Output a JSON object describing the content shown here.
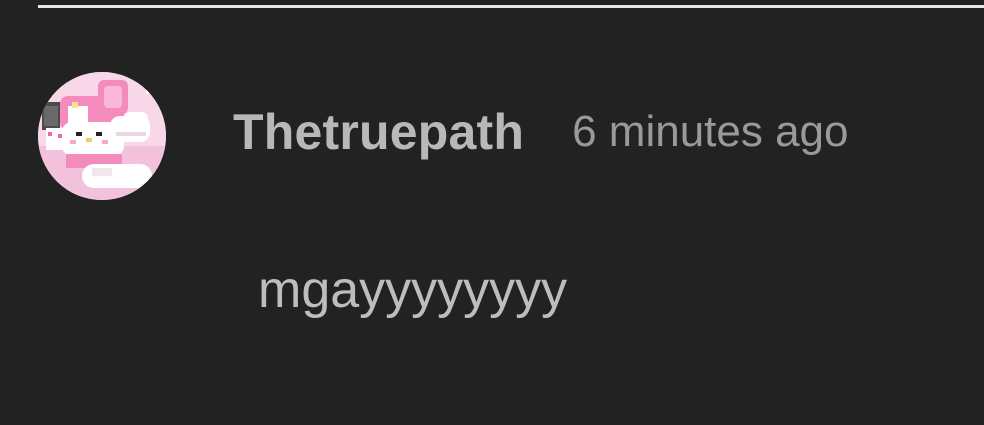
{
  "comment": {
    "author": "Thetruepath",
    "timestamp": "6 minutes ago",
    "text": "mgayyyyyyyy",
    "avatar_icon": "my-melody-pixel-avatar-icon"
  },
  "colors": {
    "background": "#222222",
    "divider": "#e6e6e6",
    "author_text": "#b8b8b8",
    "timestamp_text": "#9a9a9a",
    "body_text": "#bdbdbd"
  }
}
